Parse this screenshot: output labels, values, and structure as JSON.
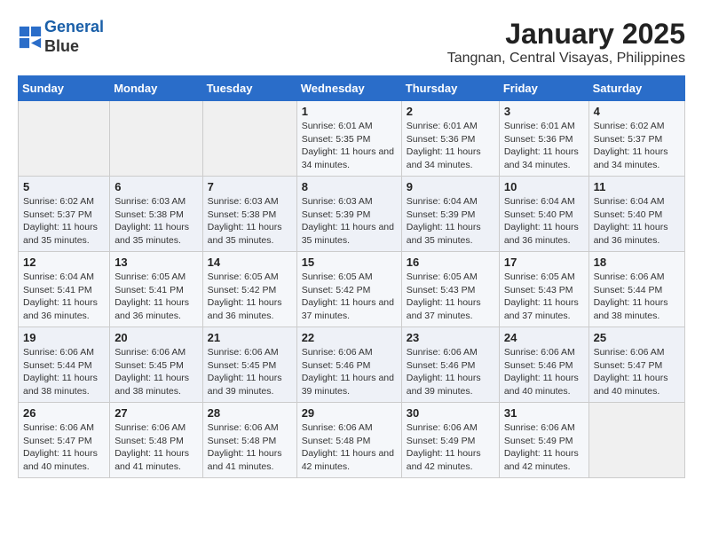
{
  "header": {
    "logo_line1": "General",
    "logo_line2": "Blue",
    "month": "January 2025",
    "location": "Tangnan, Central Visayas, Philippines"
  },
  "weekdays": [
    "Sunday",
    "Monday",
    "Tuesday",
    "Wednesday",
    "Thursday",
    "Friday",
    "Saturday"
  ],
  "weeks": [
    [
      {
        "day": "",
        "sunrise": "",
        "sunset": "",
        "daylight": ""
      },
      {
        "day": "",
        "sunrise": "",
        "sunset": "",
        "daylight": ""
      },
      {
        "day": "",
        "sunrise": "",
        "sunset": "",
        "daylight": ""
      },
      {
        "day": "1",
        "sunrise": "Sunrise: 6:01 AM",
        "sunset": "Sunset: 5:35 PM",
        "daylight": "Daylight: 11 hours and 34 minutes."
      },
      {
        "day": "2",
        "sunrise": "Sunrise: 6:01 AM",
        "sunset": "Sunset: 5:36 PM",
        "daylight": "Daylight: 11 hours and 34 minutes."
      },
      {
        "day": "3",
        "sunrise": "Sunrise: 6:01 AM",
        "sunset": "Sunset: 5:36 PM",
        "daylight": "Daylight: 11 hours and 34 minutes."
      },
      {
        "day": "4",
        "sunrise": "Sunrise: 6:02 AM",
        "sunset": "Sunset: 5:37 PM",
        "daylight": "Daylight: 11 hours and 34 minutes."
      }
    ],
    [
      {
        "day": "5",
        "sunrise": "Sunrise: 6:02 AM",
        "sunset": "Sunset: 5:37 PM",
        "daylight": "Daylight: 11 hours and 35 minutes."
      },
      {
        "day": "6",
        "sunrise": "Sunrise: 6:03 AM",
        "sunset": "Sunset: 5:38 PM",
        "daylight": "Daylight: 11 hours and 35 minutes."
      },
      {
        "day": "7",
        "sunrise": "Sunrise: 6:03 AM",
        "sunset": "Sunset: 5:38 PM",
        "daylight": "Daylight: 11 hours and 35 minutes."
      },
      {
        "day": "8",
        "sunrise": "Sunrise: 6:03 AM",
        "sunset": "Sunset: 5:39 PM",
        "daylight": "Daylight: 11 hours and 35 minutes."
      },
      {
        "day": "9",
        "sunrise": "Sunrise: 6:04 AM",
        "sunset": "Sunset: 5:39 PM",
        "daylight": "Daylight: 11 hours and 35 minutes."
      },
      {
        "day": "10",
        "sunrise": "Sunrise: 6:04 AM",
        "sunset": "Sunset: 5:40 PM",
        "daylight": "Daylight: 11 hours and 36 minutes."
      },
      {
        "day": "11",
        "sunrise": "Sunrise: 6:04 AM",
        "sunset": "Sunset: 5:40 PM",
        "daylight": "Daylight: 11 hours and 36 minutes."
      }
    ],
    [
      {
        "day": "12",
        "sunrise": "Sunrise: 6:04 AM",
        "sunset": "Sunset: 5:41 PM",
        "daylight": "Daylight: 11 hours and 36 minutes."
      },
      {
        "day": "13",
        "sunrise": "Sunrise: 6:05 AM",
        "sunset": "Sunset: 5:41 PM",
        "daylight": "Daylight: 11 hours and 36 minutes."
      },
      {
        "day": "14",
        "sunrise": "Sunrise: 6:05 AM",
        "sunset": "Sunset: 5:42 PM",
        "daylight": "Daylight: 11 hours and 36 minutes."
      },
      {
        "day": "15",
        "sunrise": "Sunrise: 6:05 AM",
        "sunset": "Sunset: 5:42 PM",
        "daylight": "Daylight: 11 hours and 37 minutes."
      },
      {
        "day": "16",
        "sunrise": "Sunrise: 6:05 AM",
        "sunset": "Sunset: 5:43 PM",
        "daylight": "Daylight: 11 hours and 37 minutes."
      },
      {
        "day": "17",
        "sunrise": "Sunrise: 6:05 AM",
        "sunset": "Sunset: 5:43 PM",
        "daylight": "Daylight: 11 hours and 37 minutes."
      },
      {
        "day": "18",
        "sunrise": "Sunrise: 6:06 AM",
        "sunset": "Sunset: 5:44 PM",
        "daylight": "Daylight: 11 hours and 38 minutes."
      }
    ],
    [
      {
        "day": "19",
        "sunrise": "Sunrise: 6:06 AM",
        "sunset": "Sunset: 5:44 PM",
        "daylight": "Daylight: 11 hours and 38 minutes."
      },
      {
        "day": "20",
        "sunrise": "Sunrise: 6:06 AM",
        "sunset": "Sunset: 5:45 PM",
        "daylight": "Daylight: 11 hours and 38 minutes."
      },
      {
        "day": "21",
        "sunrise": "Sunrise: 6:06 AM",
        "sunset": "Sunset: 5:45 PM",
        "daylight": "Daylight: 11 hours and 39 minutes."
      },
      {
        "day": "22",
        "sunrise": "Sunrise: 6:06 AM",
        "sunset": "Sunset: 5:46 PM",
        "daylight": "Daylight: 11 hours and 39 minutes."
      },
      {
        "day": "23",
        "sunrise": "Sunrise: 6:06 AM",
        "sunset": "Sunset: 5:46 PM",
        "daylight": "Daylight: 11 hours and 39 minutes."
      },
      {
        "day": "24",
        "sunrise": "Sunrise: 6:06 AM",
        "sunset": "Sunset: 5:46 PM",
        "daylight": "Daylight: 11 hours and 40 minutes."
      },
      {
        "day": "25",
        "sunrise": "Sunrise: 6:06 AM",
        "sunset": "Sunset: 5:47 PM",
        "daylight": "Daylight: 11 hours and 40 minutes."
      }
    ],
    [
      {
        "day": "26",
        "sunrise": "Sunrise: 6:06 AM",
        "sunset": "Sunset: 5:47 PM",
        "daylight": "Daylight: 11 hours and 40 minutes."
      },
      {
        "day": "27",
        "sunrise": "Sunrise: 6:06 AM",
        "sunset": "Sunset: 5:48 PM",
        "daylight": "Daylight: 11 hours and 41 minutes."
      },
      {
        "day": "28",
        "sunrise": "Sunrise: 6:06 AM",
        "sunset": "Sunset: 5:48 PM",
        "daylight": "Daylight: 11 hours and 41 minutes."
      },
      {
        "day": "29",
        "sunrise": "Sunrise: 6:06 AM",
        "sunset": "Sunset: 5:48 PM",
        "daylight": "Daylight: 11 hours and 42 minutes."
      },
      {
        "day": "30",
        "sunrise": "Sunrise: 6:06 AM",
        "sunset": "Sunset: 5:49 PM",
        "daylight": "Daylight: 11 hours and 42 minutes."
      },
      {
        "day": "31",
        "sunrise": "Sunrise: 6:06 AM",
        "sunset": "Sunset: 5:49 PM",
        "daylight": "Daylight: 11 hours and 42 minutes."
      },
      {
        "day": "",
        "sunrise": "",
        "sunset": "",
        "daylight": ""
      }
    ]
  ]
}
